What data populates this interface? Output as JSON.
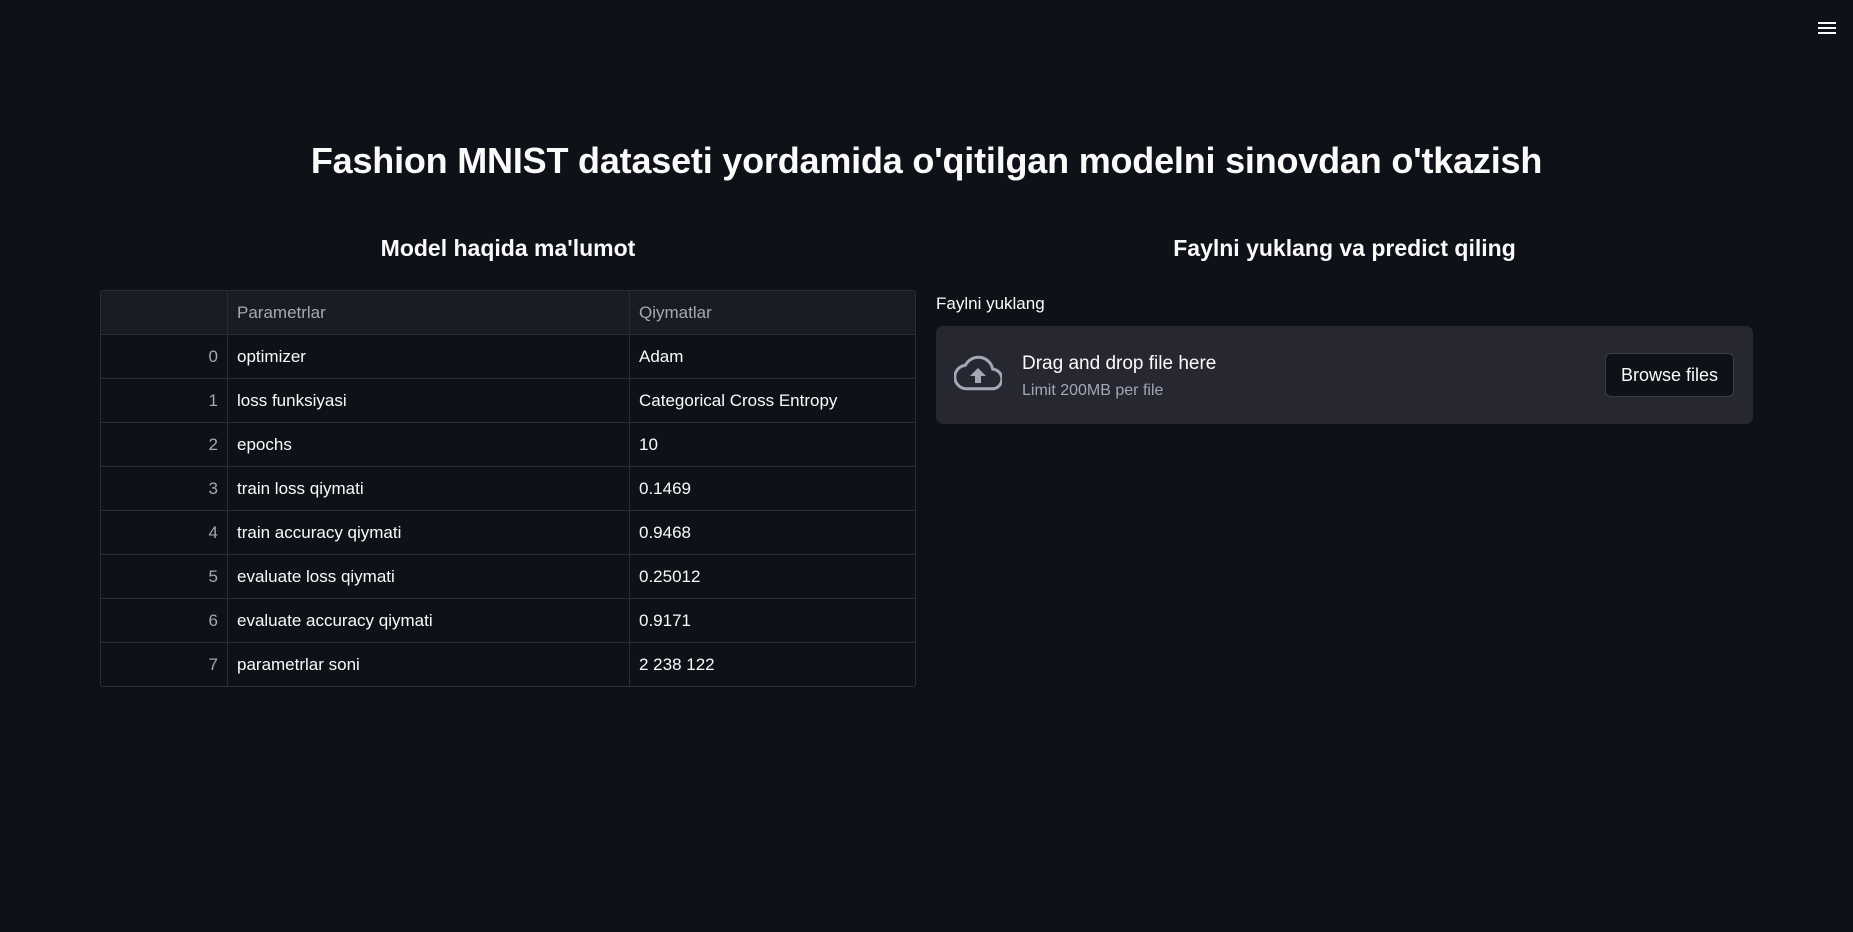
{
  "header": {
    "menu_icon": "hamburger-menu-icon"
  },
  "title": "Fashion MNIST dataseti yordamida o'qitilgan modelni sinovdan o'tkazish",
  "left": {
    "heading": "Model haqida ma'lumot",
    "table": {
      "columns": [
        "",
        "Parametrlar",
        "Qiymatlar"
      ],
      "rows": [
        {
          "index": "0",
          "param": "optimizer",
          "value": "Adam"
        },
        {
          "index": "1",
          "param": "loss funksiyasi",
          "value": "Categorical Cross Entropy"
        },
        {
          "index": "2",
          "param": "epochs",
          "value": "10"
        },
        {
          "index": "3",
          "param": "train loss qiymati",
          "value": "0.1469"
        },
        {
          "index": "4",
          "param": "train accuracy qiymati",
          "value": "0.9468"
        },
        {
          "index": "5",
          "param": "evaluate loss qiymati",
          "value": "0.25012"
        },
        {
          "index": "6",
          "param": "evaluate accuracy qiymati",
          "value": "0.9171"
        },
        {
          "index": "7",
          "param": "parametrlar soni",
          "value": "2 238 122"
        }
      ]
    }
  },
  "right": {
    "heading": "Faylni yuklang va predict qiling",
    "uploader": {
      "label": "Faylni yuklang",
      "icon": "cloud-upload-icon",
      "drop_text": "Drag and drop file here",
      "limit_text": "Limit 200MB per file",
      "browse_label": "Browse files"
    }
  },
  "colors": {
    "background": "#0e1117",
    "dropzone": "#262730",
    "muted_text": "#a3a8b4"
  }
}
